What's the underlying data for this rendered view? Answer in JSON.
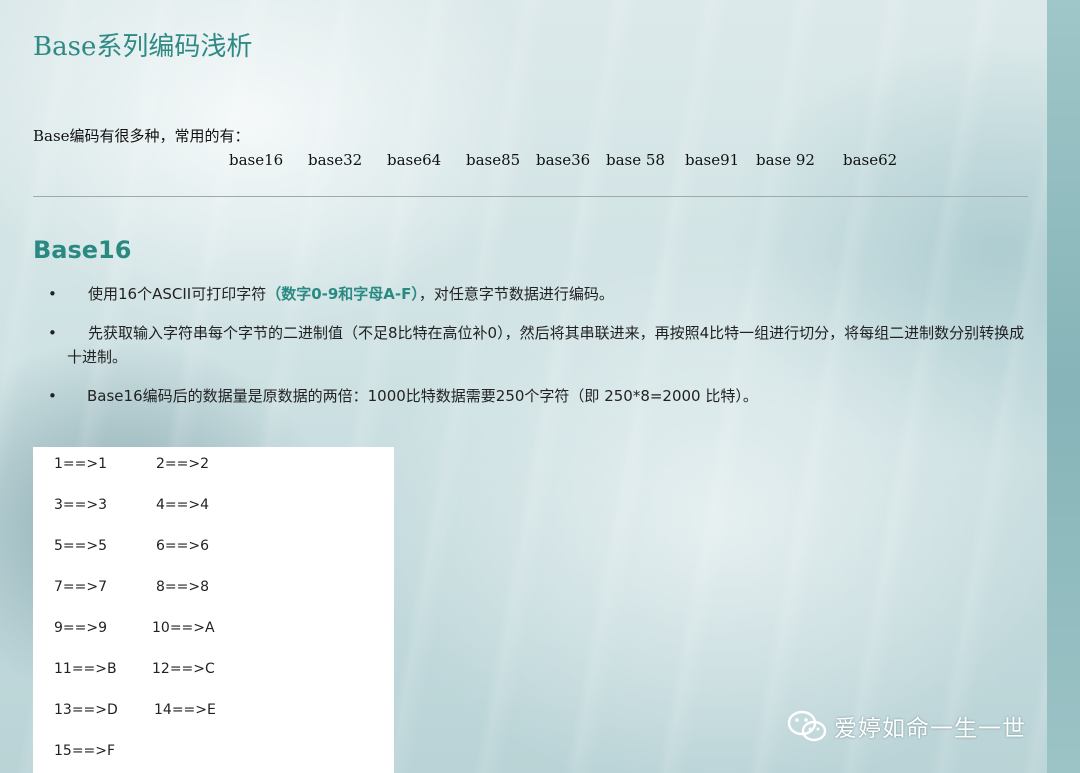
{
  "title": "Base系列编码浅析",
  "intro": "Base编码有很多种，常用的有：",
  "encoding_types": [
    "base16",
    "base32",
    "base64",
    "base85",
    "base36",
    "base 58",
    "base91",
    "base 92",
    "base62"
  ],
  "section": {
    "heading": "Base16",
    "bullets": [
      {
        "before": "使用16个ASCII可打印字符",
        "highlight": "（数字0-9和字母A-F）",
        "after": "，对任意字节数据进行编码。"
      },
      {
        "text": " 先获取输入字符串每个字节的二进制值（不足8比特在高位补0），然后将其串联进来，再按照4比特一组进行切分，将每组二进制数分别转换成十进制。"
      },
      {
        "text": "Base16编码后的数据量是原数据的两倍：1000比特数据需要250个字符（即 250*8=2000 比特）。"
      }
    ]
  },
  "mapping": [
    [
      "1==>1",
      "2==>2"
    ],
    [
      "3==>3",
      "4==>4"
    ],
    [
      "5==>5",
      "6==>6"
    ],
    [
      "7==>7",
      "8==>8"
    ],
    [
      "9==>9",
      "10==>A"
    ],
    [
      "11==>B",
      "12==>C"
    ],
    [
      "13==>D",
      "14==>E"
    ],
    [
      "15==>F",
      ""
    ]
  ],
  "watermark": {
    "icon": "wechat-icon",
    "text": "爱婷如命一生一世"
  },
  "colors": {
    "accent": "#2a8a82",
    "title": "#2f8a86"
  }
}
